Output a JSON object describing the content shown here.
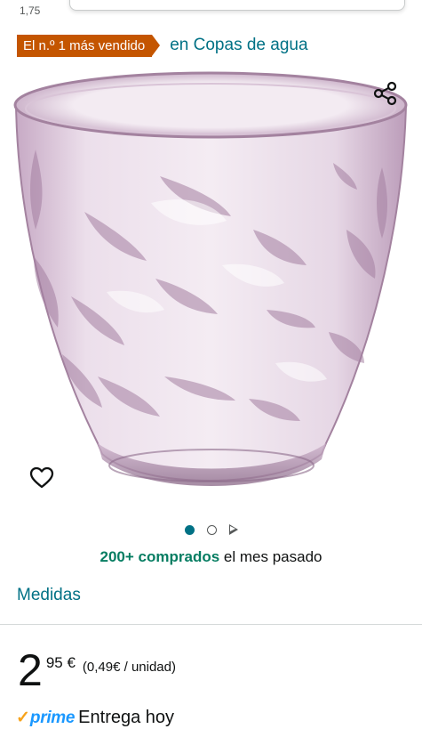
{
  "top": {
    "stub_text": "1,75",
    "search_bar": ""
  },
  "badge": {
    "label": "El n.º 1 más vendido",
    "category": "en Copas de agua",
    "color": "#c45500"
  },
  "product": {
    "image_alt": "",
    "share_icon": "share-icon",
    "wishlist_icon": "heart-icon",
    "glass_tint": "#d9c6d8"
  },
  "carousel": {
    "active_index": 0,
    "items": [
      "image",
      "image",
      "video"
    ]
  },
  "purchases": {
    "count": "200+ comprados",
    "rest": "el mes pasado"
  },
  "size": {
    "label": "Medidas"
  },
  "price": {
    "whole": "2",
    "cents": "95 €",
    "unit": "(0,49€ / unidad)"
  },
  "delivery": {
    "prime_check": "✓",
    "prime_label": "prime",
    "text": "Entrega hoy"
  },
  "colors": {
    "link": "#007185",
    "accent_green": "#067d62",
    "prime_blue": "#1a98ff",
    "prime_orange": "#f7a31c"
  }
}
